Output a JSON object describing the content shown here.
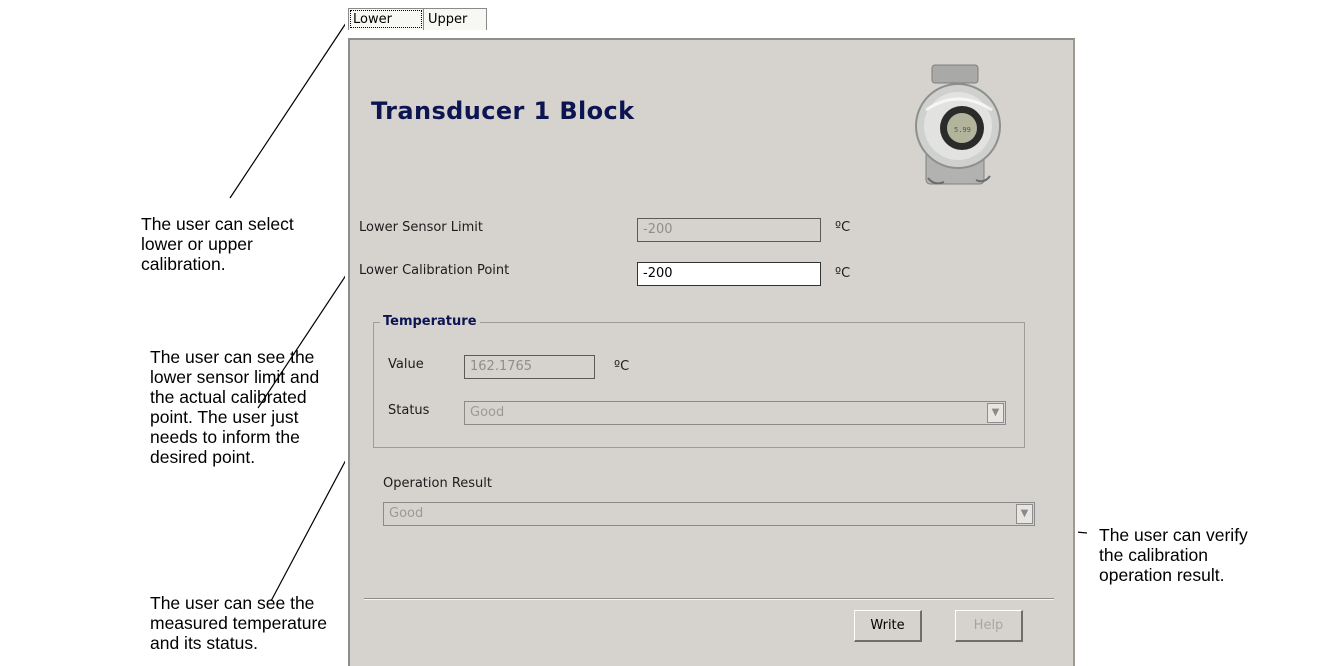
{
  "tabs": [
    {
      "label": "Lower",
      "active": true
    },
    {
      "label": "Upper",
      "active": false
    }
  ],
  "panel": {
    "title": "Transducer 1 Block",
    "device_image": "temperature-transmitter-device",
    "fields": {
      "lower_sensor_limit": {
        "label": "Lower Sensor Limit",
        "value": "-200",
        "unit": "ºC",
        "editable": false
      },
      "lower_calibration_point": {
        "label": "Lower Calibration Point",
        "value": "-200",
        "unit": "ºC",
        "editable": true
      }
    },
    "temperature": {
      "title": "Temperature",
      "value_label": "Value",
      "value": "162.1765",
      "value_unit": "ºC",
      "status_label": "Status",
      "status": "Good"
    },
    "operation_result": {
      "label": "Operation Result",
      "value": "Good"
    },
    "buttons": {
      "write": "Write",
      "help": "Help"
    }
  },
  "annotations": {
    "tab_note": [
      "The user can select",
      "lower or upper",
      "calibration."
    ],
    "limit_note": [
      "The user can see the",
      "lower sensor limit and",
      "the actual calibrated",
      "point. The user just",
      "needs to inform the",
      "desired point."
    ],
    "temperature_note": [
      "The user can see the",
      "measured temperature",
      "and its status."
    ],
    "result_note": [
      "The user can verify",
      "the calibration",
      "operation result."
    ]
  },
  "colors": {
    "panel_bg": "#d6d3ce",
    "title": "#0c1552",
    "page_bg": "#ffffff"
  }
}
